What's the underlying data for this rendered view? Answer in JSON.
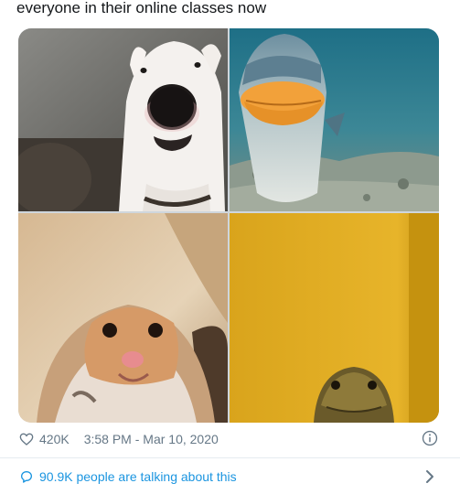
{
  "tweet": {
    "text": "everyone in their online classes now",
    "images": [
      {
        "icon": "dog-webcam-photo"
      },
      {
        "icon": "fish-webcam-photo"
      },
      {
        "icon": "hamster-webcam-photo"
      },
      {
        "icon": "lizard-webcam-photo"
      }
    ]
  },
  "meta": {
    "like_icon": "heart-icon",
    "like_count": "420K",
    "timestamp": "3:58 PM - Mar 10, 2020",
    "info_icon": "info-icon"
  },
  "conversation": {
    "icon": "chat-bubble-icon",
    "label": "90.9K people are talking about this",
    "chevron_icon": "chevron-right-icon"
  },
  "colors": {
    "link_blue": "#1b95e0",
    "meta_gray": "#657786",
    "divider": "#e6ecf0",
    "text": "#14171a"
  }
}
